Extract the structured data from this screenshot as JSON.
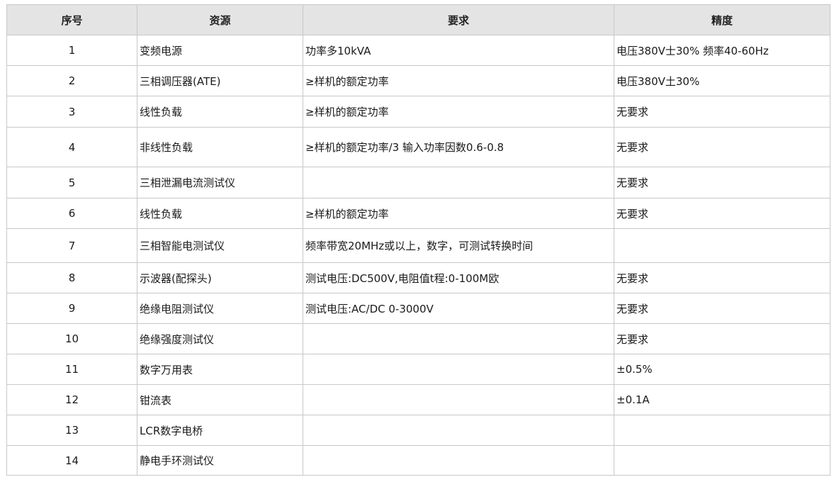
{
  "table": {
    "headers": [
      "序号",
      "资源",
      "要求",
      "精度"
    ],
    "rows": [
      {
        "no": "1",
        "resource": "变频电源",
        "requirement": "功率多10kVA",
        "accuracy": "电压380V士30%  频率40-60Hz"
      },
      {
        "no": "2",
        "resource": "三相调压器(ATE)",
        "requirement": "≥样机的额定功率",
        "accuracy": "电压380V土30%"
      },
      {
        "no": "3",
        "resource": "线性负载",
        "requirement": "≥样机的额定功率",
        "accuracy": "无要求"
      },
      {
        "no": "4",
        "resource": "非线性负载",
        "requirement": "≥样机的额定功率/3  输入功率因数0.6-0.8",
        "accuracy": "无要求"
      },
      {
        "no": "5",
        "resource": "三相泄漏电流测试仪",
        "requirement": "",
        "accuracy": "无要求"
      },
      {
        "no": "6",
        "resource": "线性负载",
        "requirement": "≥样机的额定功率",
        "accuracy": "无要求"
      },
      {
        "no": "7",
        "resource": "三相智能电测试仪",
        "requirement": "频率带宽20MHz或以上，数字，可测试转换时间",
        "accuracy": ""
      },
      {
        "no": "8",
        "resource": "示波器(配探头)",
        "requirement": "测试电压:DC500V,电阻值t程:0-100M欧",
        "accuracy": "无要求"
      },
      {
        "no": "9",
        "resource": "绝缘电阻测试仪",
        "requirement": "测试电压:AC/DC 0-3000V",
        "accuracy": "无要求"
      },
      {
        "no": "10",
        "resource": "绝缘强度测试仪",
        "requirement": "",
        "accuracy": "无要求"
      },
      {
        "no": "11",
        "resource": "数字万用表",
        "requirement": "",
        "accuracy": "±0.5%"
      },
      {
        "no": "12",
        "resource": "钳流表",
        "requirement": "",
        "accuracy": "±0.1A"
      },
      {
        "no": "13",
        "resource": "LCR数字电桥",
        "requirement": "",
        "accuracy": ""
      },
      {
        "no": "14",
        "resource": "静电手环测试仪",
        "requirement": "",
        "accuracy": ""
      }
    ]
  },
  "colors": {
    "header_bg": "#e4e4e4",
    "border": "#c8c8c8",
    "text": "#1a1a1a"
  }
}
